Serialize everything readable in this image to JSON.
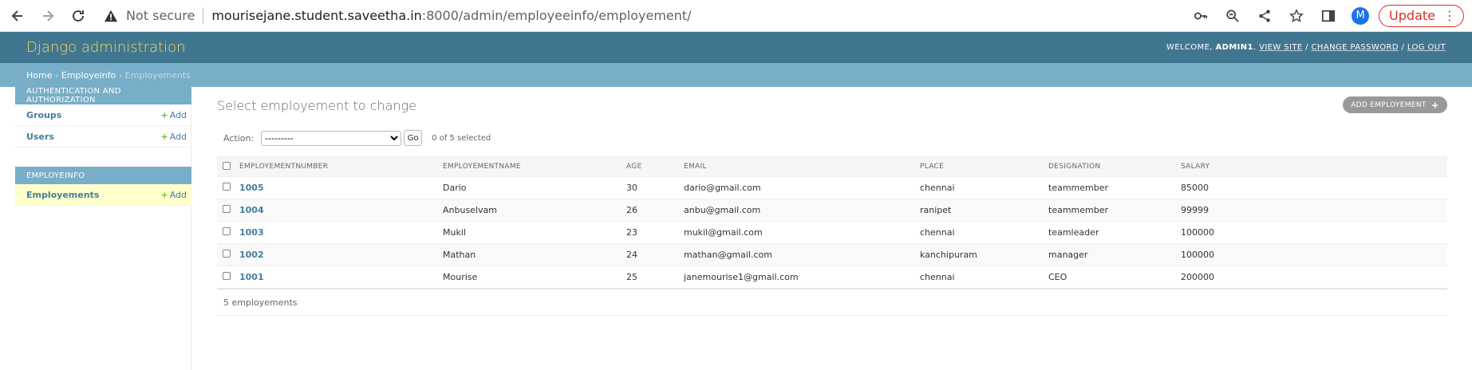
{
  "browser": {
    "not_secure": "Not secure",
    "url_host": "mourisejane.student.saveetha.in",
    "url_rest": ":8000/admin/employeeinfo/employement/",
    "avatar_letter": "M",
    "update_label": "Update",
    "update_menu": "⋮"
  },
  "header": {
    "branding": "Django administration",
    "welcome": "Welcome,",
    "username": "admin1",
    "view_site": "View site",
    "change_password": "Change password",
    "log_out": "Log out",
    "sep": " / "
  },
  "breadcrumbs": {
    "home": "Home",
    "app": "Employeinfo",
    "current": "Employements",
    "sep": "›"
  },
  "sidebar": {
    "modules": [
      {
        "caption": "Authentication and Authorization",
        "items": [
          {
            "label": "Groups",
            "add": "Add"
          },
          {
            "label": "Users",
            "add": "Add"
          }
        ]
      },
      {
        "caption": "Employeinfo",
        "items": [
          {
            "label": "Employements",
            "add": "Add"
          }
        ]
      }
    ]
  },
  "content": {
    "title": "Select employement to change",
    "add_button": "Add employement",
    "action_label": "Action:",
    "action_selected": "---------",
    "go": "Go",
    "selected_count": "0 of 5 selected",
    "columns": [
      "EMPLOYEMENTNUMBER",
      "EMPLOYEMENTNAME",
      "AGE",
      "EMAIL",
      "PLACE",
      "DESIGNATION",
      "SALARY"
    ],
    "rows": [
      [
        "1005",
        "Dario",
        "30",
        "dario@gmail.com",
        "chennai",
        "teammember",
        "85000"
      ],
      [
        "1004",
        "Anbuselvam",
        "26",
        "anbu@gmail.com",
        "ranipet",
        "teammember",
        "99999"
      ],
      [
        "1003",
        "Mukil",
        "23",
        "mukil@gmail.com",
        "chennai",
        "teamleader",
        "100000"
      ],
      [
        "1002",
        "Mathan",
        "24",
        "mathan@gmail.com",
        "kanchipuram",
        "manager",
        "100000"
      ],
      [
        "1001",
        "Mourise",
        "25",
        "janemourise1@gmail.com",
        "chennai",
        "CEO",
        "200000"
      ]
    ],
    "paginator": "5 employements"
  },
  "colors": {
    "header_bg": "#417690",
    "branding": "#f5dd5d",
    "breadcrumbs_bg": "#79aec8",
    "link": "#447e9b",
    "add_plus": "#70bf2b",
    "current_row_bg": "#ffffcc"
  }
}
